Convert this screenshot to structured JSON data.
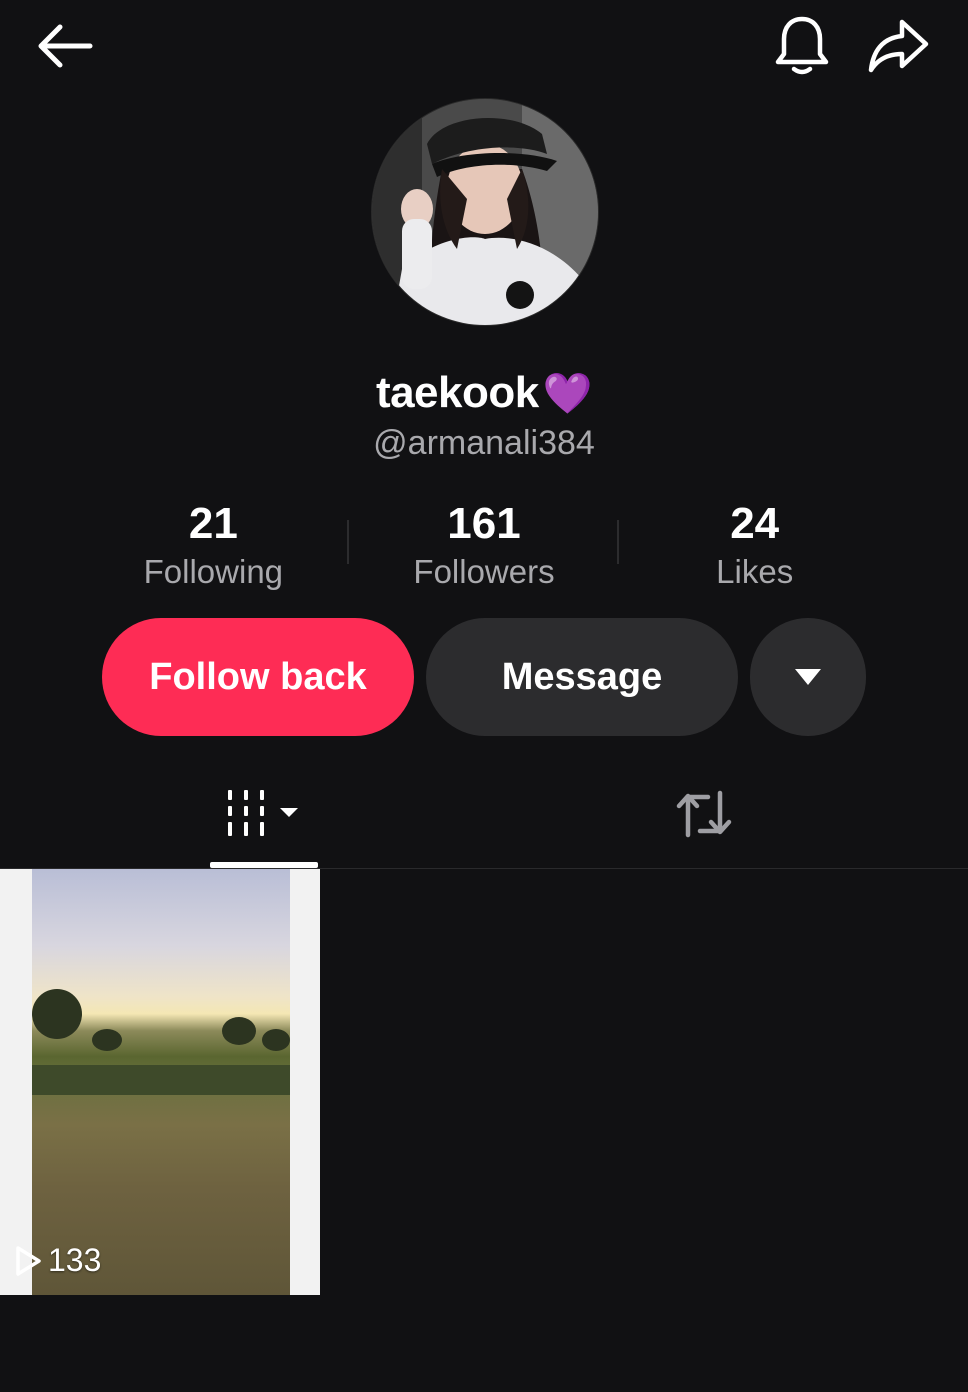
{
  "header": {
    "back_icon": "arrow-left-icon",
    "bell_icon": "bell-icon",
    "share_icon": "share-arrow-icon"
  },
  "profile": {
    "display_name": "taekook",
    "display_name_emoji": "💜",
    "handle": "@armanali384"
  },
  "stats": [
    {
      "value": "21",
      "label": "Following"
    },
    {
      "value": "161",
      "label": "Followers"
    },
    {
      "value": "24",
      "label": "Likes"
    }
  ],
  "actions": {
    "follow_label": "Follow back",
    "message_label": "Message",
    "more_icon": "caret-down-icon"
  },
  "tabs": [
    {
      "icon": "grid-filter-icon",
      "active": true
    },
    {
      "icon": "repost-icon",
      "active": false
    }
  ],
  "videos": [
    {
      "views": "133",
      "play_icon": "play-outline-icon"
    }
  ],
  "colors": {
    "background": "#111113",
    "accent": "#fe2c55",
    "secondary_button": "#2c2c2e",
    "muted_text": "#a9a9ad"
  }
}
